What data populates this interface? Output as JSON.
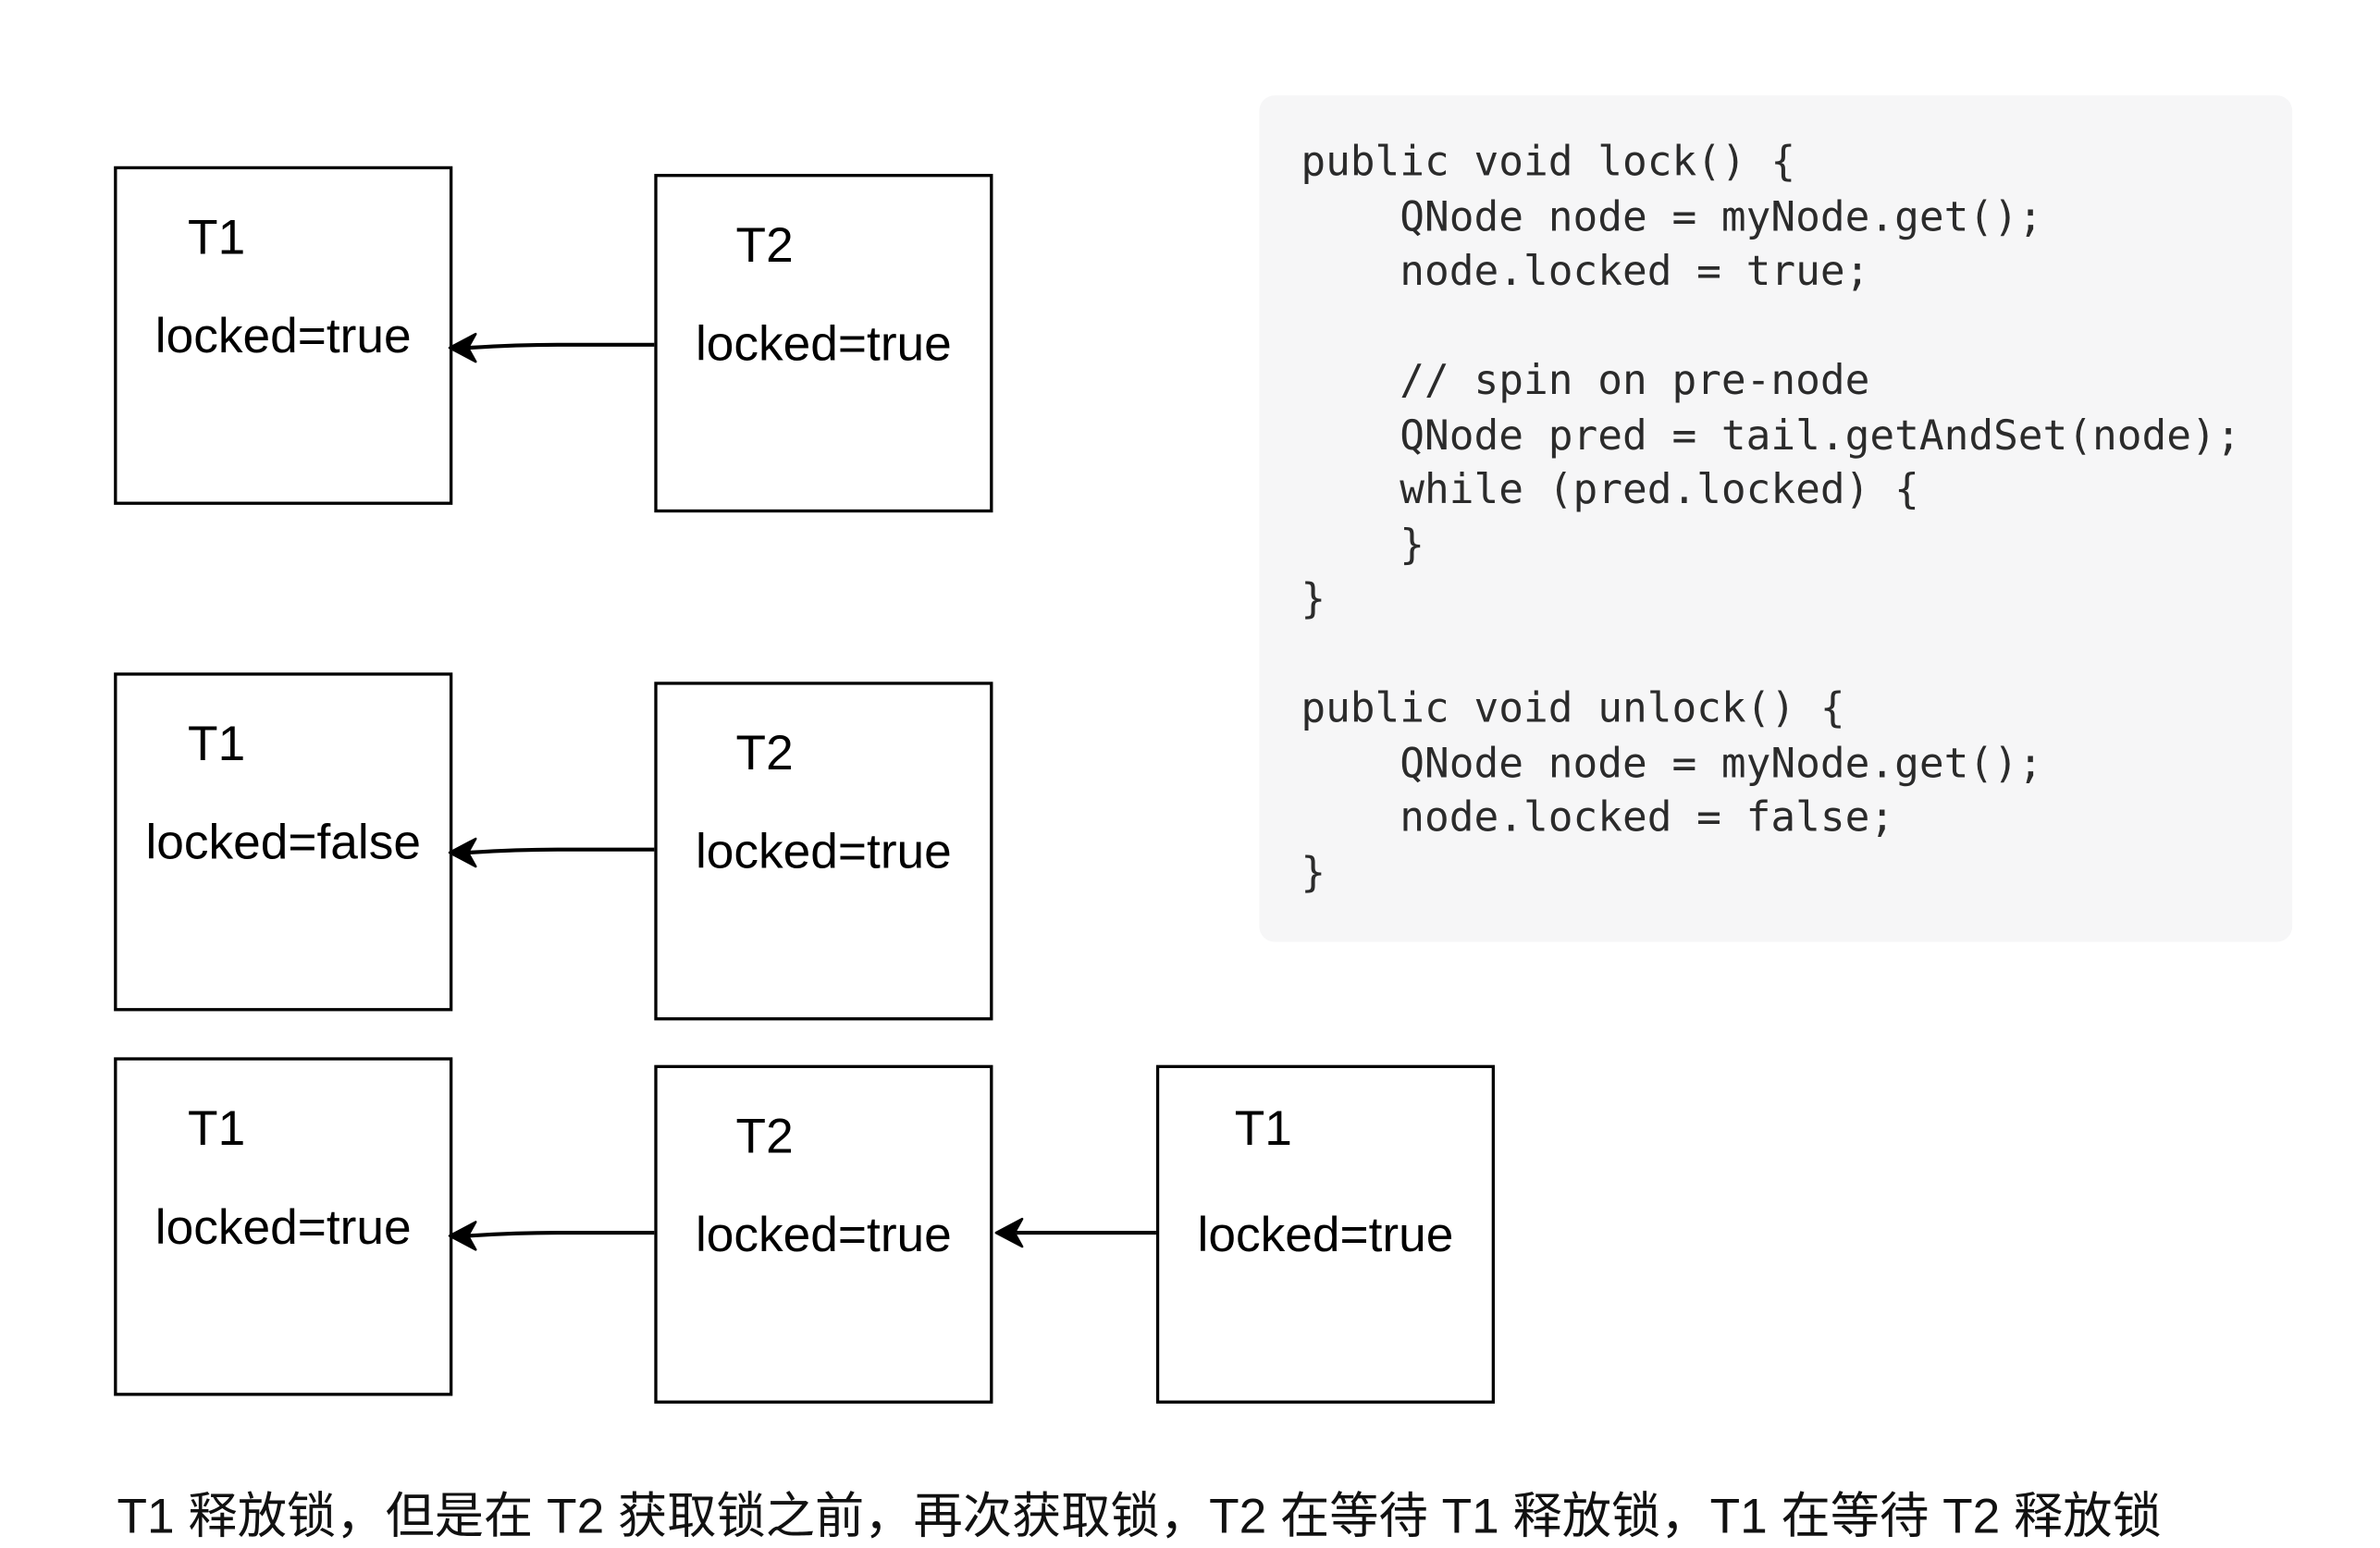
{
  "diagram": {
    "rows": [
      {
        "nodes": [
          {
            "thread": "T1",
            "state": "locked=true"
          },
          {
            "thread": "T2",
            "state": "locked=true"
          }
        ]
      },
      {
        "nodes": [
          {
            "thread": "T1",
            "state": "locked=false"
          },
          {
            "thread": "T2",
            "state": "locked=true"
          }
        ]
      },
      {
        "nodes": [
          {
            "thread": "T1",
            "state": "locked=true"
          },
          {
            "thread": "T2",
            "state": "locked=true"
          },
          {
            "thread": "T1",
            "state": "locked=true"
          }
        ]
      }
    ]
  },
  "code": {
    "lines": [
      "public void lock() {",
      "    QNode node = myNode.get();",
      "    node.locked = true;",
      "",
      "    // spin on pre-node",
      "    QNode pred = tail.getAndSet(node);",
      "    while (pred.locked) {",
      "    }",
      "}",
      "",
      "public void unlock() {",
      "    QNode node = myNode.get();",
      "    node.locked = false;",
      "}"
    ]
  },
  "caption": "T1 释放锁，但是在 T2 获取锁之前，再次获取锁，T2 在等待 T1 释放锁，T1 在等待 T2 释放锁",
  "colors": {
    "code_background": "#f6f6f7",
    "stroke": "#000000",
    "code_text": "#2b2b2b"
  }
}
